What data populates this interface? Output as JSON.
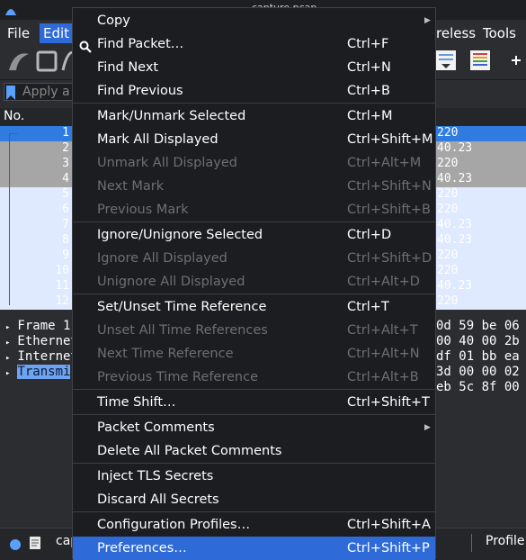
{
  "window": {
    "title": "capture.pcap"
  },
  "menubar": {
    "file": "File",
    "edit": "Edit",
    "wireless": "reless",
    "tools": "Tools"
  },
  "filter": {
    "placeholder": "Apply a d"
  },
  "packet_list": {
    "column_no": "No.",
    "rows": [
      {
        "no": "1",
        "dst": "220"
      },
      {
        "no": "2",
        "dst": "40.23"
      },
      {
        "no": "3",
        "dst": "220"
      },
      {
        "no": "4",
        "dst": "40.23"
      },
      {
        "no": "5",
        "dst": "220"
      },
      {
        "no": "6",
        "dst": "220"
      },
      {
        "no": "7",
        "dst": "40.23"
      },
      {
        "no": "8",
        "dst": "40.23"
      },
      {
        "no": "9",
        "dst": "220"
      },
      {
        "no": "10",
        "dst": "220"
      },
      {
        "no": "11",
        "dst": "40.23"
      },
      {
        "no": "12",
        "dst": "220"
      }
    ]
  },
  "detail": {
    "lines": [
      "Frame 1",
      "Ethernet",
      "Internet",
      "Transmi"
    ]
  },
  "bytes": {
    "lines": [
      "0d 59 be 06",
      "00 40 00 2b",
      "df 01 bb ea",
      "3d 00 00 02",
      "eb 5c 8f 00"
    ]
  },
  "status": {
    "file": "cap",
    "profile": "Profile"
  },
  "edit_menu": {
    "items": [
      {
        "label": "Copy",
        "shortcut": "",
        "submenu": true,
        "disabled": false
      },
      {
        "label": "Find Packet…",
        "shortcut": "Ctrl+F",
        "disabled": false
      },
      {
        "label": "Find Next",
        "shortcut": "Ctrl+N",
        "disabled": false
      },
      {
        "label": "Find Previous",
        "shortcut": "Ctrl+B",
        "disabled": false
      },
      {
        "label": "Mark/Unmark Selected",
        "shortcut": "Ctrl+M",
        "disabled": false
      },
      {
        "label": "Mark All Displayed",
        "shortcut": "Ctrl+Shift+M",
        "disabled": false
      },
      {
        "label": "Unmark All Displayed",
        "shortcut": "Ctrl+Alt+M",
        "disabled": true
      },
      {
        "label": "Next Mark",
        "shortcut": "Ctrl+Shift+N",
        "disabled": true
      },
      {
        "label": "Previous Mark",
        "shortcut": "Ctrl+Shift+B",
        "disabled": true
      },
      {
        "label": "Ignore/Unignore Selected",
        "shortcut": "Ctrl+D",
        "disabled": false
      },
      {
        "label": "Ignore All Displayed",
        "shortcut": "Ctrl+Shift+D",
        "disabled": true
      },
      {
        "label": "Unignore All Displayed",
        "shortcut": "Ctrl+Alt+D",
        "disabled": true
      },
      {
        "label": "Set/Unset Time Reference",
        "shortcut": "Ctrl+T",
        "disabled": false
      },
      {
        "label": "Unset All Time References",
        "shortcut": "Ctrl+Alt+T",
        "disabled": true
      },
      {
        "label": "Next Time Reference",
        "shortcut": "Ctrl+Alt+N",
        "disabled": true
      },
      {
        "label": "Previous Time Reference",
        "shortcut": "Ctrl+Alt+B",
        "disabled": true
      },
      {
        "label": "Time Shift…",
        "shortcut": "Ctrl+Shift+T",
        "disabled": false
      },
      {
        "label": "Packet Comments",
        "shortcut": "",
        "submenu": true,
        "disabled": false
      },
      {
        "label": "Delete All Packet Comments",
        "shortcut": "",
        "disabled": false
      },
      {
        "label": "Inject TLS Secrets",
        "shortcut": "",
        "disabled": false
      },
      {
        "label": "Discard All Secrets",
        "shortcut": "",
        "disabled": false
      },
      {
        "label": "Configuration Profiles…",
        "shortcut": "Ctrl+Shift+A",
        "disabled": false
      },
      {
        "label": "Preferences…",
        "shortcut": "Ctrl+Shift+P",
        "disabled": false,
        "active": true
      }
    ]
  },
  "colors": {
    "accent": "#2f6bd8",
    "selected_row": "#2f7be0",
    "marked_row": "#a6a6a6",
    "row_bg": "#dfe9ff",
    "menu_bg": "#1c1d21",
    "disabled_text": "#6c6f75"
  }
}
